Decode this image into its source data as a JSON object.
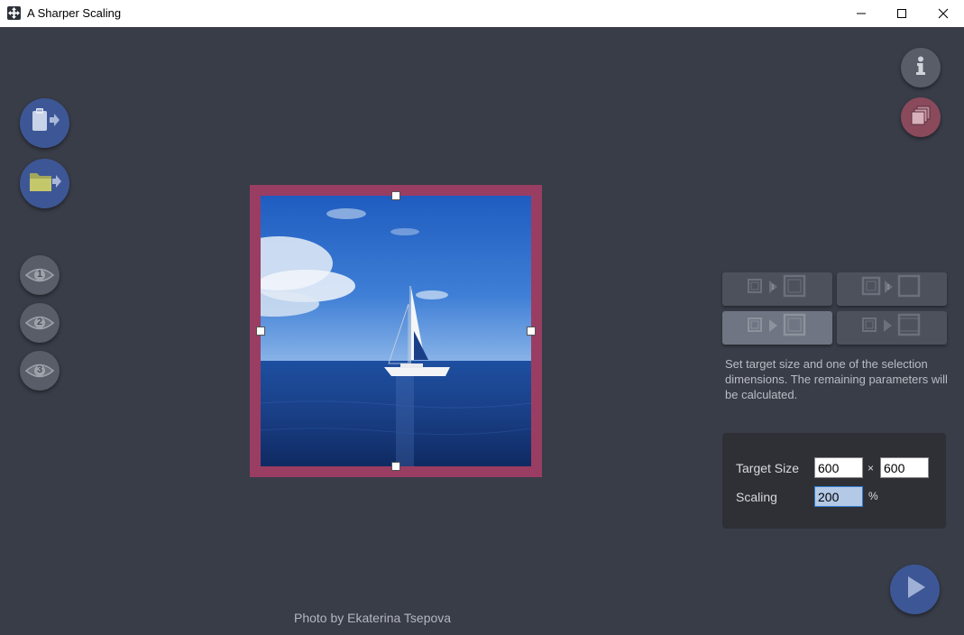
{
  "window": {
    "title": "A Sharper Scaling"
  },
  "left_toolbar": {
    "preview_buttons": [
      {
        "label": "1"
      },
      {
        "label": "2"
      },
      {
        "label": "3"
      }
    ]
  },
  "image": {
    "credit": "Photo by Ekaterina Tsepova"
  },
  "modes": {
    "active_index": 2
  },
  "help_text": "Set target size and one of the selection dimensions. The remaining parameters will be calculated.",
  "params": {
    "target_size_label": "Target Size",
    "width": "600",
    "times": "×",
    "height": "600",
    "scaling_label": "Scaling",
    "scaling": "200",
    "percent": "%"
  },
  "colors": {
    "background": "#393d48",
    "accent_blue": "#3d5796",
    "frame": "#9a3d62"
  }
}
